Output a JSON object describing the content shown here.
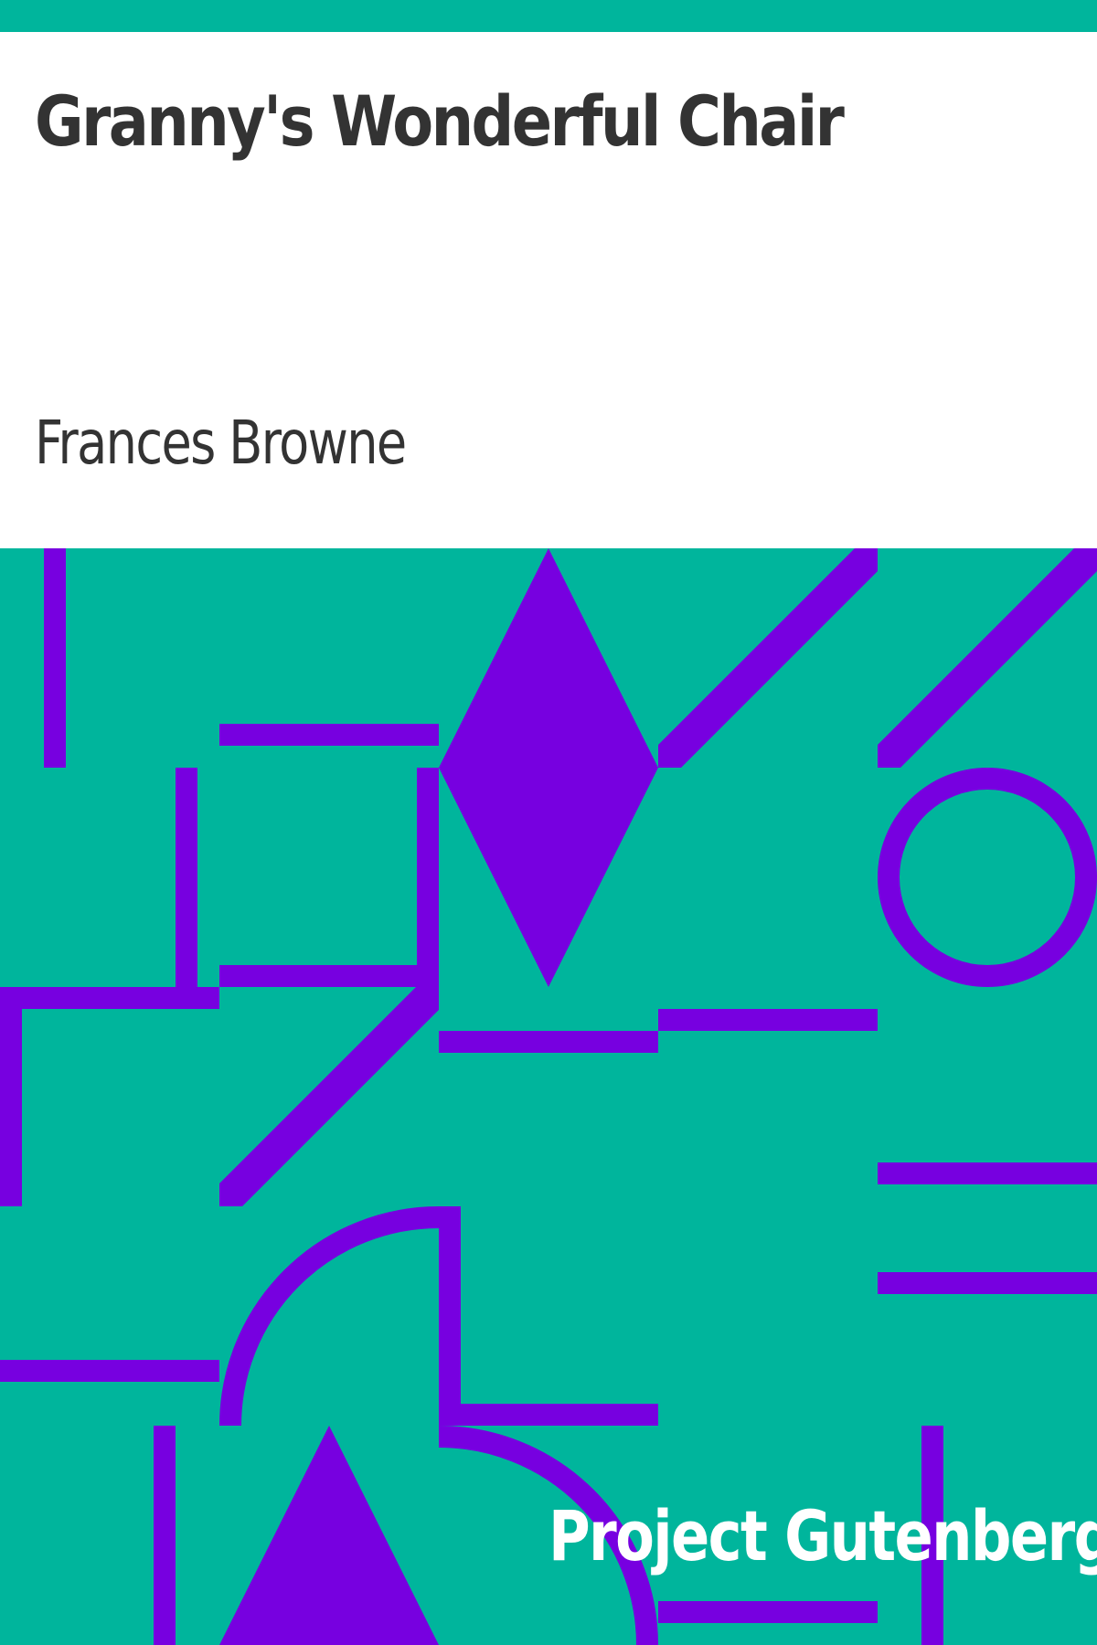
{
  "cover": {
    "title": "Granny's Wonderful Chair",
    "author": "Frances Browne",
    "publisher": "Project Gutenberg"
  },
  "colors": {
    "background_teal": "#00b59c",
    "shape_purple": "#7700e0",
    "text_dark": "#333333",
    "text_light": "#ffffff"
  }
}
